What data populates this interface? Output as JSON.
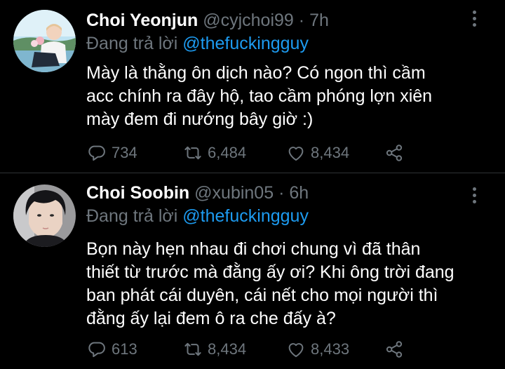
{
  "tweets": [
    {
      "name": "Choi Yeonjun",
      "handle": "@cyjchoi99",
      "separator": "·",
      "time": "7h",
      "reply_prefix": "Đang trả lời",
      "reply_to": "@thefuckingguy",
      "text_lines": [
        "Mày là thằng ôn dịch nào? Có ngon thì cầm",
        "acc chính ra đây hộ, tao cầm phóng lợn xiên",
        "mày đem đi nướng bây giờ :)"
      ],
      "replies": "734",
      "retweets": "6,484",
      "likes": "8,434"
    },
    {
      "name": "Choi Soobin",
      "handle": "@xubin05",
      "separator": "·",
      "time": "6h",
      "reply_prefix": "Đang trả lời",
      "reply_to": "@thefuckingguy",
      "text_lines": [
        "Bọn này hẹn nhau đi chơi chung vì đã thân",
        "thiết từ trước mà đằng ấy ơi? Khi ông trời đang",
        "ban phát cái duyên, cái nết cho mọi người thì",
        "đằng ấy lại đem ô ra che đấy à?"
      ],
      "replies": "613",
      "retweets": "8,434",
      "likes": "8,433"
    }
  ],
  "icons": {
    "reply": "comment-icon",
    "retweet": "retweet-icon",
    "like": "heart-icon",
    "share": "share-icon",
    "more": "more-vertical-icon"
  },
  "colors": {
    "background": "#000000",
    "text": "#ffffff",
    "muted": "#6e767d",
    "link": "#1d9bf0",
    "divider": "#2f3336"
  }
}
